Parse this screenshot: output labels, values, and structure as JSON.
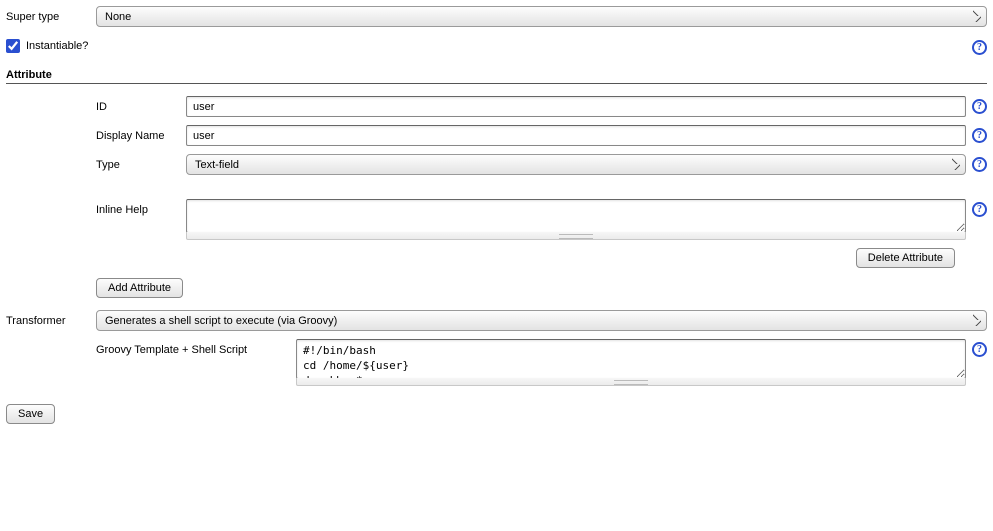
{
  "super_type": {
    "label": "Super type",
    "value": "None"
  },
  "instantiable": {
    "label": "Instantiable?",
    "checked": true
  },
  "attribute_section": {
    "header": "Attribute",
    "id": {
      "label": "ID",
      "value": "user"
    },
    "display_name": {
      "label": "Display Name",
      "value": "user"
    },
    "type": {
      "label": "Type",
      "value": "Text-field"
    },
    "inline_help": {
      "label": "Inline Help",
      "value": ""
    },
    "delete_btn": "Delete Attribute",
    "add_btn": "Add Attribute"
  },
  "transformer": {
    "label": "Transformer",
    "value": "Generates a shell script to execute (via Groovy)"
  },
  "script": {
    "label": "Groovy Template + Shell Script",
    "value": "#!/bin/bash\ncd /home/${user}\ndu -khs *"
  },
  "save_btn": "Save",
  "help_glyph": "?"
}
